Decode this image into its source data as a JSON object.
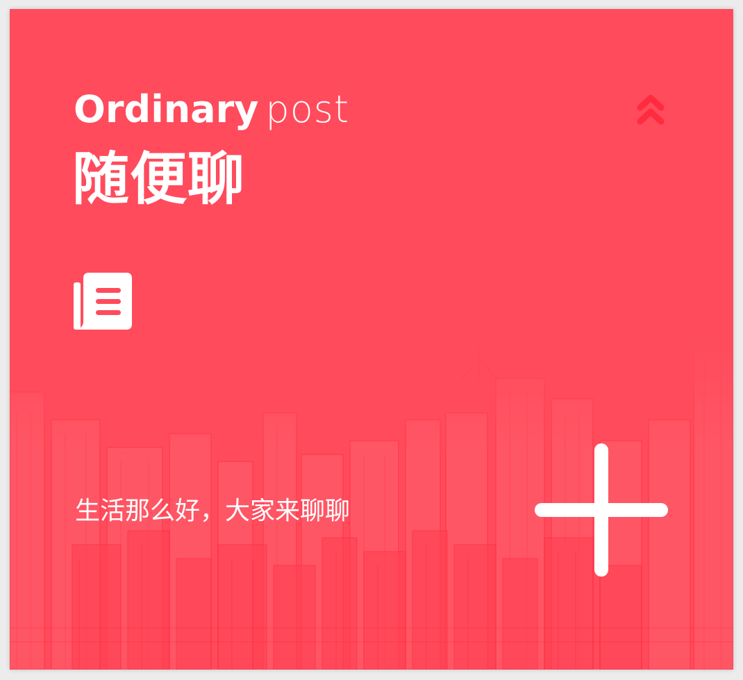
{
  "card": {
    "title_en_bold": "Ordinary",
    "title_en_light": "post",
    "title_cn": "随便聊",
    "tagline": "生活那么好，大家来聊聊"
  },
  "icons": {
    "collapse": "double-chevron-up-icon",
    "post": "newspaper-icon",
    "add": "plus-icon",
    "background": "city-skyline-sketch"
  },
  "colors": {
    "background": "#ff4b5c",
    "accent_icon": "#ff2b3f",
    "text": "#ffffff",
    "page": "#ececec"
  }
}
